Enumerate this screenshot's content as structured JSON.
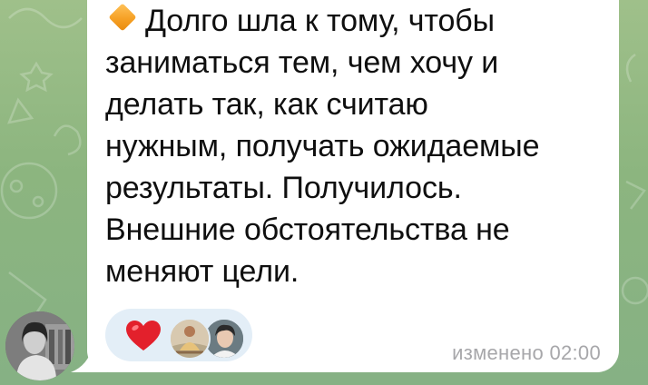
{
  "message": {
    "lines": [
      "Долго шла к тому, чтобы",
      "заниматься тем, чем хочу и",
      "делать так, как считаю",
      "нужным, получать ожидаемые",
      "результаты. Получилось.",
      "Внешние обстоятельства не",
      "меняют цели."
    ],
    "edited_label": "изменено",
    "time": "02:00"
  },
  "reactions": {
    "emoji_icon": "red-heart-icon",
    "reactor_count_shown": 2
  },
  "colors": {
    "bubble": "#ffffff",
    "text": "#0f0f0f",
    "meta": "#a7a7aa",
    "reaction_pill": "#e3eef7",
    "heart": "#e3202c",
    "diamond": "#f6a126",
    "wallpaper": "#8fb680"
  },
  "icons": {
    "lead_emoji": "orange-diamond-icon"
  }
}
